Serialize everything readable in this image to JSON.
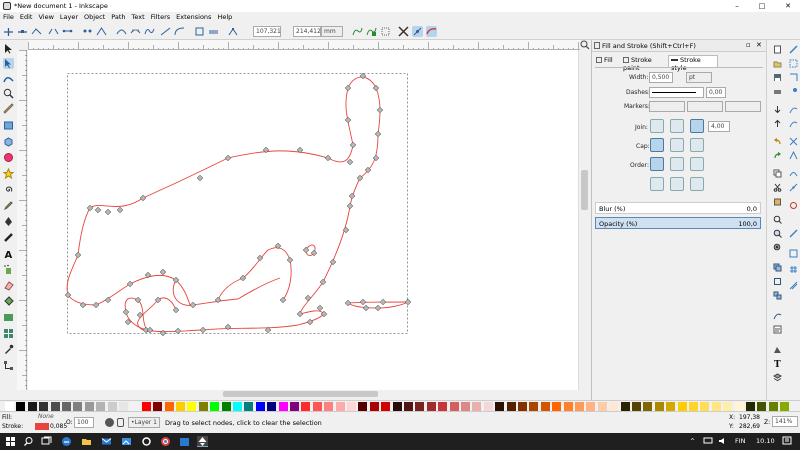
{
  "window": {
    "title": "*New document 1 - Inkscape",
    "minimize": "–",
    "maximize": "□",
    "close": "✕"
  },
  "menu": [
    "File",
    "Edit",
    "View",
    "Layer",
    "Object",
    "Path",
    "Text",
    "Filters",
    "Extensions",
    "Help"
  ],
  "node_toolbar": {
    "x_label": "X:",
    "x_value": "107,321",
    "y_label": "Y:",
    "y_value": "214,412",
    "unit": "mm"
  },
  "tools": [
    "selector-tool",
    "node-tool",
    "tweak-tool",
    "zoom-tool",
    "measure-tool",
    "rectangle-tool",
    "3dbox-tool",
    "ellipse-tool",
    "star-tool",
    "spiral-tool",
    "pencil-tool",
    "pen-tool",
    "calligraphy-tool",
    "text-tool",
    "spray-tool",
    "eraser-tool",
    "bucket-tool",
    "gradient-tool",
    "mesh-tool",
    "dropper-tool",
    "connector-tool"
  ],
  "panel": {
    "title": "Fill and Stroke (Shift+Ctrl+F)",
    "tabs": {
      "fill": "Fill",
      "stroke_paint": "Stroke paint",
      "stroke_style": "Stroke style"
    },
    "width_label": "Width:",
    "width_value": "0,500",
    "width_unit": "pt",
    "dashes_label": "Dashes:",
    "dash_offset": "0,00",
    "markers_label": "Markers:",
    "join_label": "Join:",
    "miter_value": "4,00",
    "cap_label": "Cap:",
    "order_label": "Order:",
    "blur_label": "Blur (%)",
    "blur_value": "0,0",
    "opacity_label": "Opacity (%)",
    "opacity_value": "100,0"
  },
  "status": {
    "fill_label": "Fill:",
    "fill_value": "None",
    "stroke_label": "Stroke:",
    "stroke_value": "0,085",
    "opacity_label": "O:",
    "opacity_value": "100",
    "layer": "•Layer 1",
    "message": "Drag to select nodes, click to clear the selection",
    "x_label": "X:",
    "x_value": "197,38",
    "y_label": "Y:",
    "y_value": "282,69",
    "z_label": "Z:",
    "zoom_value": "141%"
  },
  "taskbar": {
    "language": "FIN",
    "time": "10.10"
  },
  "colors": {
    "path_stroke": "#e8463c",
    "node_fill": "#b9b9b9",
    "accent": "#3b7fc4"
  }
}
